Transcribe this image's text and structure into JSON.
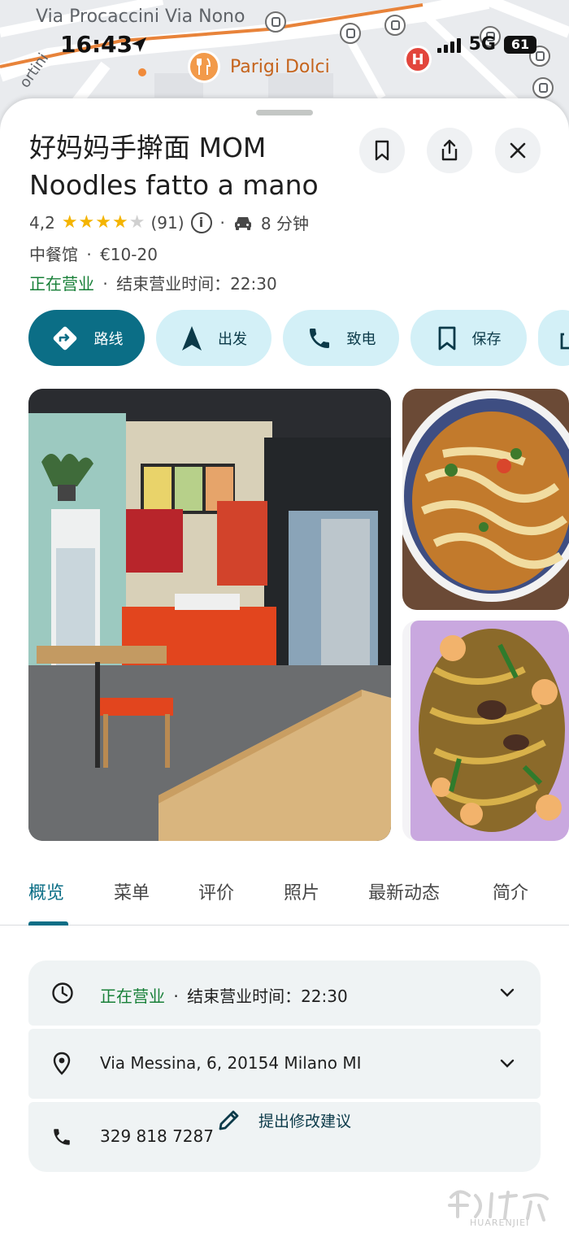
{
  "status_bar": {
    "time": "16:43",
    "network": "5G",
    "battery": "61"
  },
  "map": {
    "street_label": "Via Procaccini Via Nono",
    "poi_label": "Parigi Dolci",
    "side_label": "ortini",
    "hospital_badge": "H"
  },
  "place": {
    "title": "好妈妈手擀面 MOM Noodles fatto a mano",
    "rating": "4,2",
    "stars_filled": 4,
    "review_count": "(91)",
    "drive_time": "8 分钟",
    "category": "中餐馆",
    "price_range": "€10-20",
    "status": "正在营业",
    "closing_text": "结束营业时间：22:30"
  },
  "header_buttons": [
    "bookmark-icon",
    "share-icon",
    "close-icon"
  ],
  "actions": [
    {
      "label": "路线",
      "icon": "directions-icon"
    },
    {
      "label": "出发",
      "icon": "navigation-icon"
    },
    {
      "label": "致电",
      "icon": "phone-icon"
    },
    {
      "label": "保存",
      "icon": "bookmark-icon"
    }
  ],
  "tabs": [
    "概览",
    "菜单",
    "评价",
    "照片",
    "最新动态",
    "简介"
  ],
  "active_tab": "概览",
  "info": {
    "hours_status": "正在营业",
    "hours_text": "结束营业时间：22:30",
    "address": "Via Messina, 6, 20154 Milano MI",
    "phone": "329 818 7287"
  },
  "suggest_edit": "提出修改建议",
  "watermark_text": "HUARENJIEI",
  "colors": {
    "accent": "#0b6e86",
    "chip_bg": "#d3f0f7",
    "open_green": "#188038",
    "star": "#f4b400"
  }
}
